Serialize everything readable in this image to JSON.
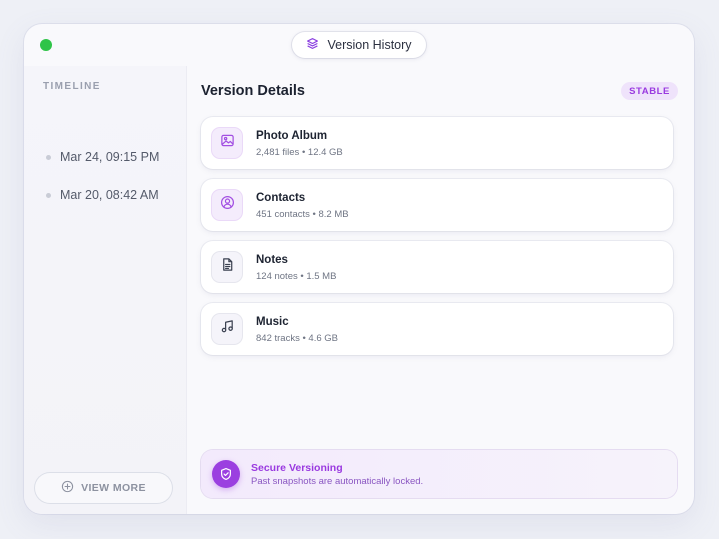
{
  "window": {
    "title": "Version History",
    "title_icon": "layers-icon",
    "status_dot_color": "#2fc448"
  },
  "sidebar": {
    "heading": "TIMELINE",
    "items": [
      {
        "label": "Mar 24, 09:15 PM"
      },
      {
        "label": "Mar 20, 08:42 AM"
      }
    ],
    "view_more_label": "VIEW MORE",
    "view_more_icon": "plus-circle-icon"
  },
  "details": {
    "title": "Version Details",
    "badge": "STABLE",
    "accent_color": "#9a3ae0",
    "cards": [
      {
        "icon": "image-icon",
        "title": "Photo Album",
        "meta": "2,481 files • 12.4 GB"
      },
      {
        "icon": "user-circle-icon",
        "title": "Contacts",
        "meta": "451 contacts • 8.2 MB"
      },
      {
        "icon": "file-text-icon",
        "title": "Notes",
        "meta": "124 notes • 1.5 MB"
      },
      {
        "icon": "music-note-icon",
        "title": "Music",
        "meta": "842 tracks • 4.6 GB"
      }
    ]
  },
  "secure": {
    "icon": "shield-check-icon",
    "title": "Secure Versioning",
    "subtitle": "Past snapshots are automatically locked."
  }
}
